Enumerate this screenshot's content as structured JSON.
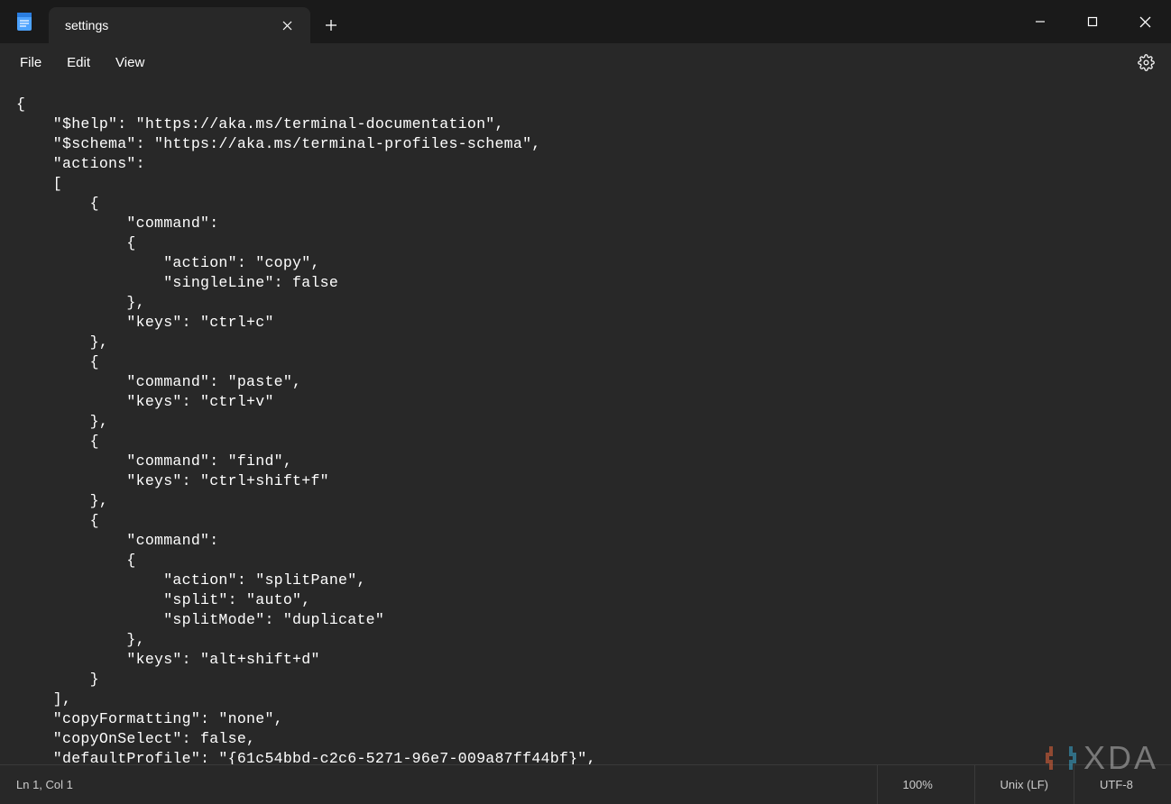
{
  "tab": {
    "title": "settings"
  },
  "menu": {
    "file": "File",
    "edit": "Edit",
    "view": "View"
  },
  "editor": {
    "content": "{\n    \"$help\": \"https://aka.ms/terminal-documentation\",\n    \"$schema\": \"https://aka.ms/terminal-profiles-schema\",\n    \"actions\": \n    [\n        {\n            \"command\": \n            {\n                \"action\": \"copy\",\n                \"singleLine\": false\n            },\n            \"keys\": \"ctrl+c\"\n        },\n        {\n            \"command\": \"paste\",\n            \"keys\": \"ctrl+v\"\n        },\n        {\n            \"command\": \"find\",\n            \"keys\": \"ctrl+shift+f\"\n        },\n        {\n            \"command\": \n            {\n                \"action\": \"splitPane\",\n                \"split\": \"auto\",\n                \"splitMode\": \"duplicate\"\n            },\n            \"keys\": \"alt+shift+d\"\n        }\n    ],\n    \"copyFormatting\": \"none\",\n    \"copyOnSelect\": false,\n    \"defaultProfile\": \"{61c54bbd-c2c6-5271-96e7-009a87ff44bf}\","
  },
  "status": {
    "position": "Ln 1, Col 1",
    "zoom": "100%",
    "line_ending": "Unix (LF)",
    "encoding": "UTF-8"
  },
  "watermark": {
    "text": "XDA"
  }
}
